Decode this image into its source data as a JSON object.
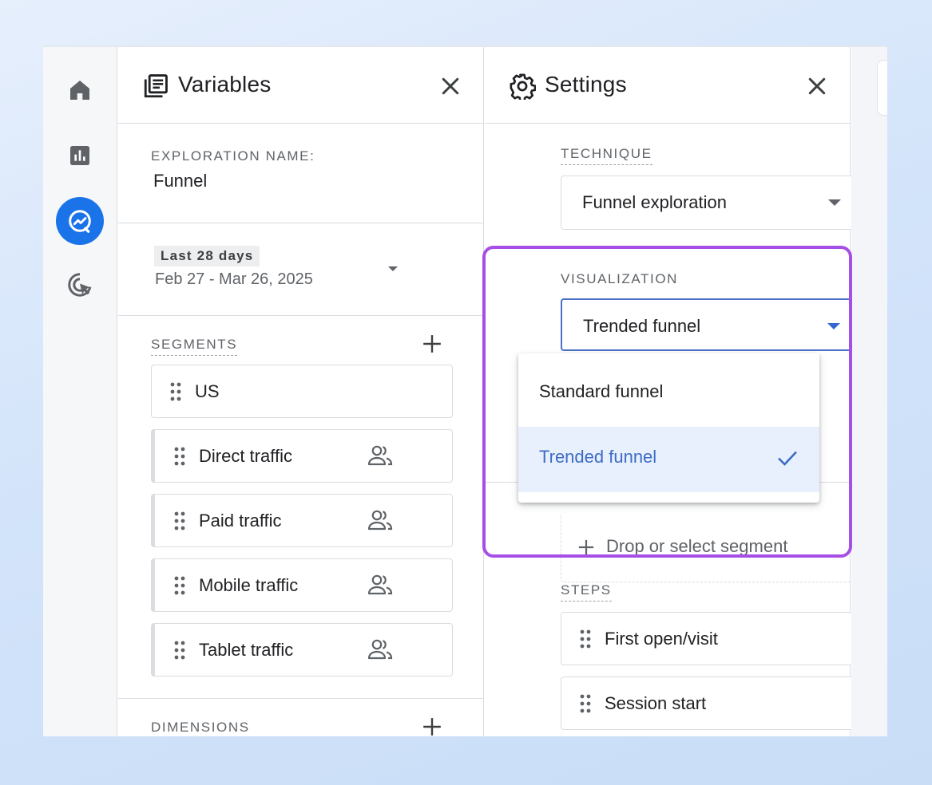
{
  "rail": {
    "items": [
      {
        "name": "home",
        "icon": "home-icon"
      },
      {
        "name": "reports",
        "icon": "bar-chart-icon"
      },
      {
        "name": "explore",
        "icon": "explore-chart-icon",
        "active": true
      },
      {
        "name": "advertising",
        "icon": "target-cursor-icon"
      }
    ]
  },
  "variables": {
    "title": "Variables",
    "exploration_name_label": "EXPLORATION NAME:",
    "exploration_name": "Funnel",
    "date_chip": "Last 28 days",
    "date_range": "Feb 27 - Mar 26, 2025",
    "segments_label": "SEGMENTS",
    "segments": [
      {
        "label": "US",
        "type": "plain"
      },
      {
        "label": "Direct traffic",
        "type": "user"
      },
      {
        "label": "Paid traffic",
        "type": "user"
      },
      {
        "label": "Mobile traffic",
        "type": "user"
      },
      {
        "label": "Tablet traffic",
        "type": "user"
      }
    ],
    "dimensions_label": "DIMENSIONS"
  },
  "settings": {
    "title": "Settings",
    "technique_label": "TECHNIQUE",
    "technique_value": "Funnel exploration",
    "visualization_label": "VISUALIZATION",
    "visualization_value": "Trended funnel",
    "visualization_options": [
      {
        "label": "Standard funnel",
        "selected": false
      },
      {
        "label": "Trended funnel",
        "selected": true
      }
    ],
    "segment_drop_label": "Drop or select segment",
    "steps_label": "STEPS",
    "steps": [
      "First open/visit",
      "Session start"
    ]
  },
  "colors": {
    "accent": "#1a73e8",
    "highlight": "#a64fe6",
    "selected_bg": "#e8f0fe",
    "selected_text": "#3d6cc4"
  }
}
